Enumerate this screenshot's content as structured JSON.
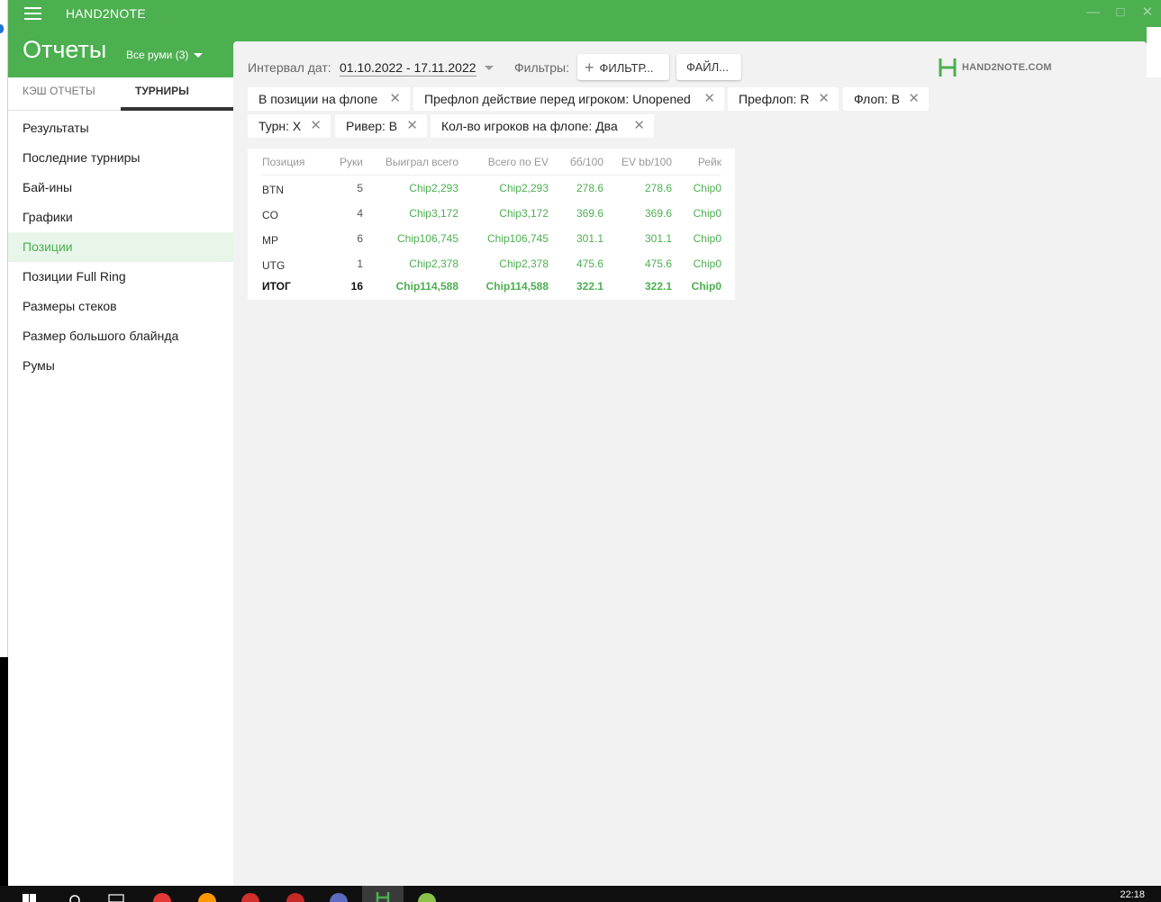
{
  "app": {
    "name": "HAND2NOTE"
  },
  "header": {
    "title": "Отчеты",
    "rooms_select": "Все руми (3)"
  },
  "sidebar": {
    "tabs": [
      {
        "label": "КЭШ ОТЧЕТЫ",
        "active": false
      },
      {
        "label": "ТУРНИРЫ",
        "active": true
      }
    ],
    "items": [
      {
        "label": "Результаты"
      },
      {
        "label": "Последние турниры"
      },
      {
        "label": "Бай-ины"
      },
      {
        "label": "Графики"
      },
      {
        "label": "Позиции",
        "active": true
      },
      {
        "label": "Позиции Full Ring"
      },
      {
        "label": "Размеры стеков"
      },
      {
        "label": "Размер большого блайнда"
      },
      {
        "label": "Румы"
      }
    ]
  },
  "toolbar": {
    "date_label": "Интервал дат:",
    "date_value": "01.10.2022 - 17.11.2022",
    "filters_label": "Фильтры:",
    "filter_button": "ФИЛЬТР...",
    "file_button": "ФАЙЛ...",
    "logo_text": "HAND2NOTE.COM"
  },
  "chips": [
    "В позиции на флопе",
    "Префлоп действие перед игроком: Unopened",
    "Префлоп: R",
    "Флоп: B",
    "Турн: X",
    "Ривер: B",
    "Кол-во игроков на флопе: Два"
  ],
  "table": {
    "headers": [
      "Позиция",
      "Руки",
      "Выиграл всего",
      "Всего по EV",
      "бб/100",
      "EV bb/100",
      "Рейк"
    ],
    "rows": [
      [
        "BTN",
        "5",
        "Chip2,293",
        "Chip2,293",
        "278.6",
        "278.6",
        "Chip0"
      ],
      [
        "CO",
        "4",
        "Chip3,172",
        "Chip3,172",
        "369.6",
        "369.6",
        "Chip0"
      ],
      [
        "MP",
        "6",
        "Chip106,745",
        "Chip106,745",
        "301.1",
        "301.1",
        "Chip0"
      ],
      [
        "UTG",
        "1",
        "Chip2,378",
        "Chip2,378",
        "475.6",
        "475.6",
        "Chip0"
      ]
    ],
    "total": [
      "ИТОГ",
      "16",
      "Chip114,588",
      "Chip114,588",
      "322.1",
      "322.1",
      "Chip0"
    ]
  },
  "taskbar": {
    "clock": "22:18"
  },
  "colors": {
    "accent": "#4caf50",
    "background": "#f2f2f2",
    "active_item_bg": "#e8f5e9"
  }
}
